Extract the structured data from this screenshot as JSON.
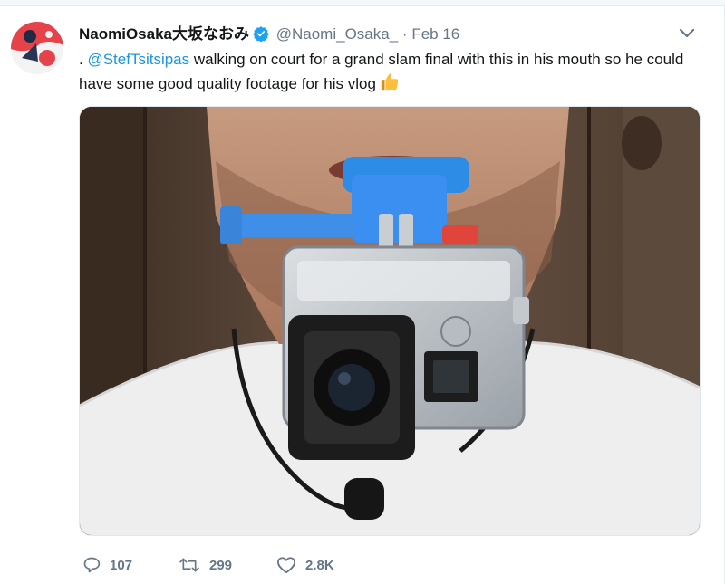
{
  "tweet": {
    "display_name": "NaomiOsaka大坂なおみ",
    "handle": "@Naomi_Osaka_",
    "separator": "·",
    "date": "Feb 16",
    "text_prefix": ". ",
    "mention": "@StefTsitsipas",
    "text_body": " walking on court for a grand slam final with this in his mouth so he could have some good quality footage for his vlog",
    "emoji_icon": "thumbs-up-icon",
    "media_alt": "Man holding a GoPro action camera in its waterproof case with a blue mouth mount between his teeth"
  },
  "actions": {
    "replies": "107",
    "retweets": "299",
    "likes": "2.8K"
  },
  "colors": {
    "link": "#1b95e0",
    "verified": "#1da1f2",
    "muted": "#657786"
  }
}
